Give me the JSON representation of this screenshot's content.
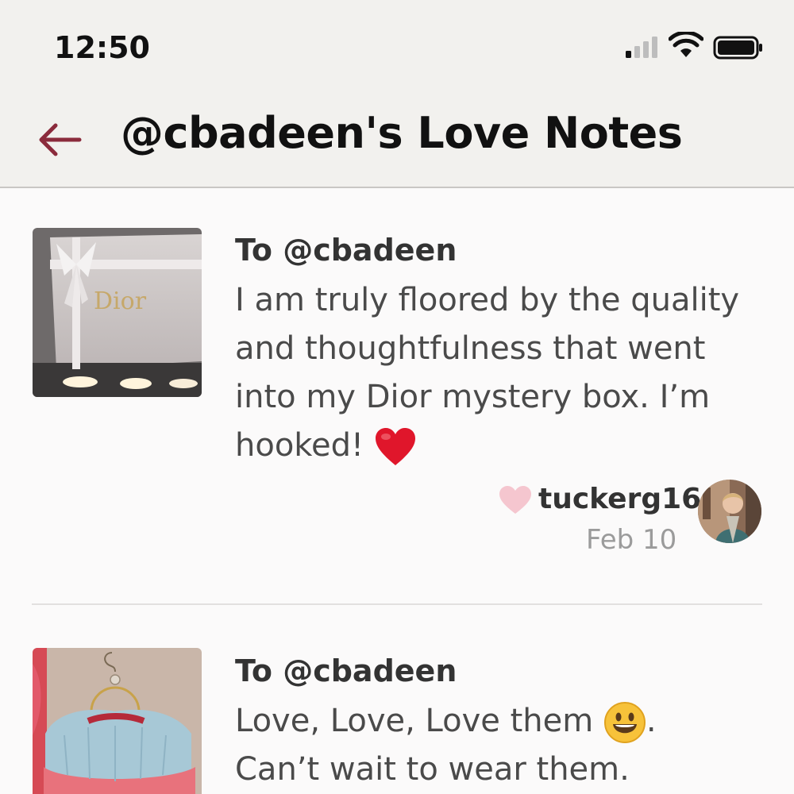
{
  "status_bar": {
    "time": "12:50",
    "icons": [
      "cellular-signal-icon",
      "wifi-icon",
      "battery-icon"
    ]
  },
  "header": {
    "back_icon": "back-arrow-icon",
    "title": "@cbadeen's Love Notes"
  },
  "colors": {
    "accent": "#8b2b3c",
    "header_bg": "#f2f1ee",
    "heart_light": "#f5c6cf",
    "emoji_heart": "#e0162b"
  },
  "notes": [
    {
      "to": "To @cbadeen",
      "message_lines": [
        "I am truly floored by the quality",
        "and thoughtfulness that went",
        "into my Dior mystery box. I’m",
        "hooked! "
      ],
      "emoji": "red-heart-emoji",
      "thumbnail_brand_text": "Dior",
      "author": "tuckerg16",
      "date": "Feb 10"
    },
    {
      "to": "To @cbadeen",
      "message_lines": [
        "Love, Love, Love them ",
        "Can’t wait to wear them."
      ],
      "message_line1_suffix": ".",
      "emoji": "grinning-face-emoji"
    }
  ]
}
